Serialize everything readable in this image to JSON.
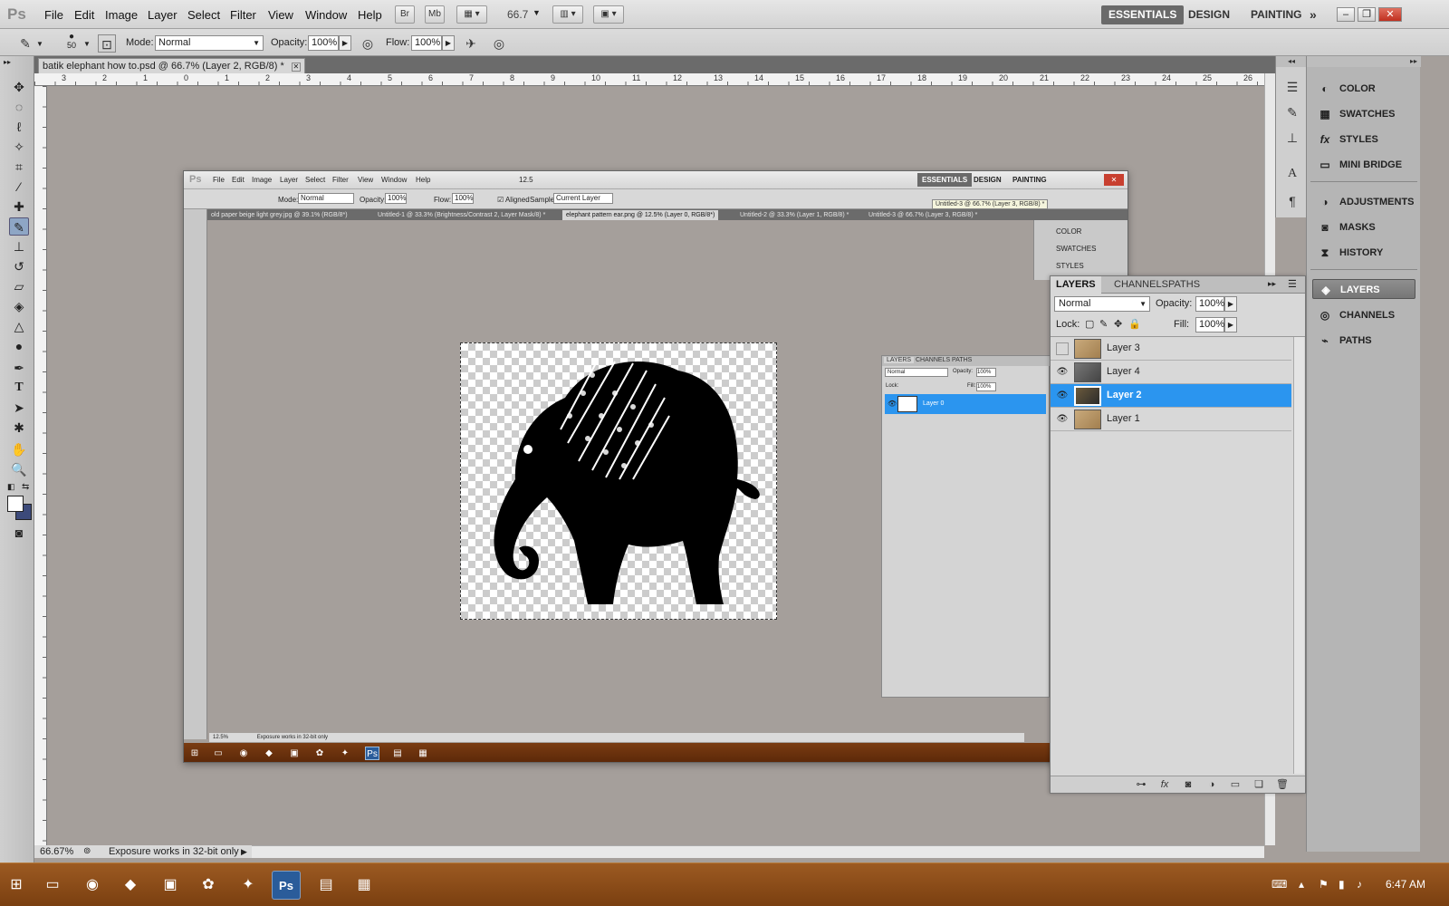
{
  "app": {
    "logo": "Ps",
    "menu": [
      "File",
      "Edit",
      "Image",
      "Layer",
      "Select",
      "Filter",
      "View",
      "Window",
      "Help"
    ],
    "bridge_btn": "Br",
    "minibridge_btn": "Mb",
    "zoom": "66.7",
    "workspaces": [
      "ESSENTIALS",
      "DESIGN",
      "PAINTING"
    ],
    "more": "»"
  },
  "options": {
    "brush_size": "50",
    "mode_label": "Mode:",
    "mode_value": "Normal",
    "opacity_label": "Opacity:",
    "opacity_value": "100%",
    "flow_label": "Flow:",
    "flow_value": "100%"
  },
  "document": {
    "tab_title": "batik elephant how to.psd @ 66.7% (Layer 2, RGB/8) *",
    "status_zoom": "66.67%",
    "status_text": "Exposure works in 32-bit only",
    "ruler_numbers": [
      "3",
      "2",
      "1",
      "0",
      "1",
      "2",
      "3",
      "4",
      "5",
      "6",
      "7",
      "8",
      "9",
      "10",
      "11",
      "12",
      "13",
      "14",
      "15",
      "16",
      "17",
      "18",
      "19",
      "20",
      "21",
      "22",
      "23",
      "24",
      "25",
      "26"
    ]
  },
  "inner": {
    "menu": [
      "File",
      "Edit",
      "Image",
      "Layer",
      "Select",
      "Filter",
      "View",
      "Window",
      "Help"
    ],
    "zoom": "12.5",
    "workspaces": [
      "ESSENTIALS",
      "DESIGN",
      "PAINTING"
    ],
    "options": {
      "mode_label": "Mode:",
      "mode_value": "Normal",
      "opacity_label": "Opacity:",
      "opacity_value": "100%",
      "flow_label": "Flow:",
      "flow_value": "100%",
      "aligned": "Aligned",
      "sample_label": "Sample:",
      "sample_value": "Current Layer"
    },
    "tabs": [
      "old paper beige light grey.jpg @ 39.1% (RGB/8*)",
      "Untitled-1 @ 33.3% (Brightness/Contrast 2, Layer Mask/8) *",
      "elephant pattern ear.png @ 12.5% (Layer 0, RGB/8*)",
      "Untitled-2 @ 33.3% (Layer 1, RGB/8) *",
      "Untitled-3 @ 66.7% (Layer 3, RGB/8) *"
    ],
    "tooltip": "Untitled-3 @ 66.7% (Layer 3, RGB/8) *",
    "dock_items": [
      "COLOR",
      "SWATCHES",
      "STYLES"
    ],
    "status_zoom": "12.5%",
    "status_text": "Exposure works in 32-bit only",
    "layers_panel": {
      "tabs": [
        "LAYERS",
        "CHANNELS",
        "PATHS"
      ],
      "blend": "Normal",
      "opacity_label": "Opacity:",
      "opacity_value": "100%",
      "lock_label": "Lock:",
      "fill_label": "Fill:",
      "fill_value": "100%",
      "layer": "Layer 0"
    }
  },
  "dock": {
    "items": [
      {
        "label": "COLOR",
        "icon": "color-icon"
      },
      {
        "label": "SWATCHES",
        "icon": "swatches-icon"
      },
      {
        "label": "STYLES",
        "icon": "styles-icon"
      },
      {
        "label": "MINI BRIDGE",
        "icon": "mini-bridge-icon"
      },
      {
        "label": "ADJUSTMENTS",
        "icon": "adjustments-icon"
      },
      {
        "label": "MASKS",
        "icon": "masks-icon"
      },
      {
        "label": "HISTORY",
        "icon": "history-icon"
      },
      {
        "label": "LAYERS",
        "icon": "layers-icon"
      },
      {
        "label": "CHANNELS",
        "icon": "channels-icon"
      },
      {
        "label": "PATHS",
        "icon": "paths-icon"
      }
    ],
    "collapse": "◂◂",
    "expand": "▸▸"
  },
  "layers": {
    "tabs": [
      "LAYERS",
      "CHANNELS",
      "PATHS"
    ],
    "blend_mode": "Normal",
    "opacity_label": "Opacity:",
    "opacity_value": "100%",
    "lock_label": "Lock:",
    "fill_label": "Fill:",
    "fill_value": "100%",
    "rows": [
      {
        "name": "Layer 3",
        "visible": false,
        "selected": false
      },
      {
        "name": "Layer 4",
        "visible": true,
        "selected": false
      },
      {
        "name": "Layer 2",
        "visible": true,
        "selected": true
      },
      {
        "name": "Layer 1",
        "visible": true,
        "selected": false
      }
    ]
  },
  "taskbar": {
    "time": "6:47 AM"
  },
  "colors": {
    "selection": "#2b95ef",
    "canvas": "#a59f9b",
    "taskbar": "#8a4c18"
  }
}
